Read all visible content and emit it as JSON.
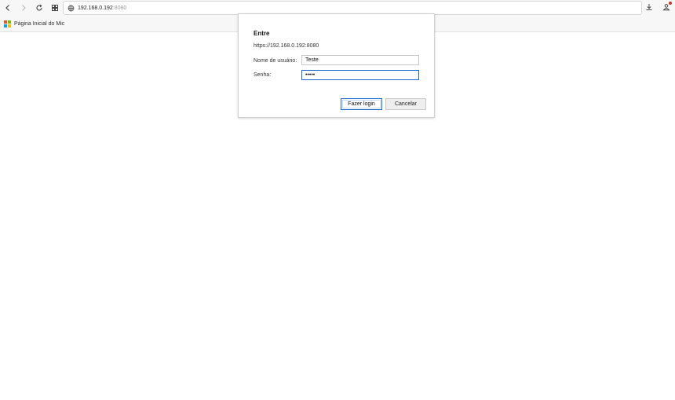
{
  "browser": {
    "address": {
      "host": "192.168.0.192",
      "port": ":8080"
    },
    "favorites": [
      {
        "label": "Página Inicial do Mic"
      }
    ]
  },
  "icons": {
    "back": "chevron-left-icon",
    "forward": "chevron-right-icon",
    "refresh": "refresh-icon",
    "tabs": "grid-icon",
    "site_info": "globe-icon",
    "downloads": "download-icon",
    "profile": "profile-icon"
  },
  "dialog": {
    "title": "Entre",
    "url": "https://192.168.0.192:8080",
    "username_label": "Nome de usuário:",
    "username_value": "Teste",
    "password_label": "Senha:",
    "password_value": "•••••",
    "login_button": "Fazer login",
    "cancel_button": "Cancelar"
  },
  "colors": {
    "accent": "#1a67d2",
    "notification": "#d32f2f"
  }
}
